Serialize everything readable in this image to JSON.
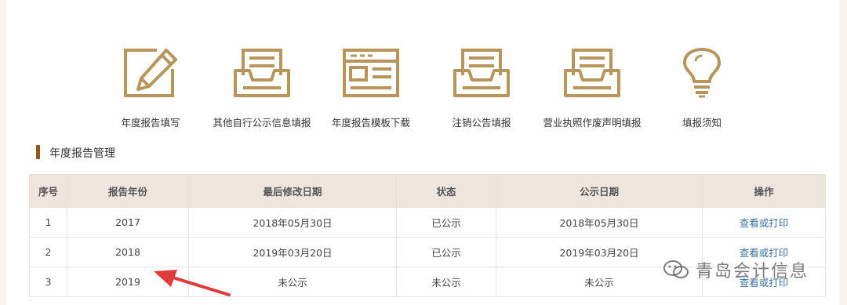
{
  "colors": {
    "accent": "#b8955a",
    "header_bg": "#eee5dc",
    "section_bar": "#8a5a1e",
    "link": "#3a6f9e",
    "arrow": "#e03a3a"
  },
  "icons": [
    {
      "label": "年度报告填写",
      "icon": "edit-icon"
    },
    {
      "label": "其他自行公示信息填报",
      "icon": "inbox-icon"
    },
    {
      "label": "年度报告模板下载",
      "icon": "template-icon"
    },
    {
      "label": "注销公告填报",
      "icon": "inbox-icon"
    },
    {
      "label": "营业执照作废声明填报",
      "icon": "inbox-icon"
    },
    {
      "label": "填报须知",
      "icon": "lightbulb-icon"
    }
  ],
  "section": {
    "title": "年度报告管理"
  },
  "table": {
    "headers": [
      "序号",
      "报告年份",
      "最后修改日期",
      "状态",
      "公示日期",
      "操作"
    ],
    "rows": [
      [
        "1",
        "2017",
        "2018年05月30日",
        "已公示",
        "2018年05月30日",
        "查看或打印"
      ],
      [
        "2",
        "2018",
        "2019年03月20日",
        "已公示",
        "2019年03月20日",
        "查看或打印"
      ],
      [
        "3",
        "2019",
        "未公示",
        "未公示",
        "未公示",
        "查看或打印"
      ]
    ]
  },
  "watermark": {
    "text": "青岛会计信息"
  }
}
